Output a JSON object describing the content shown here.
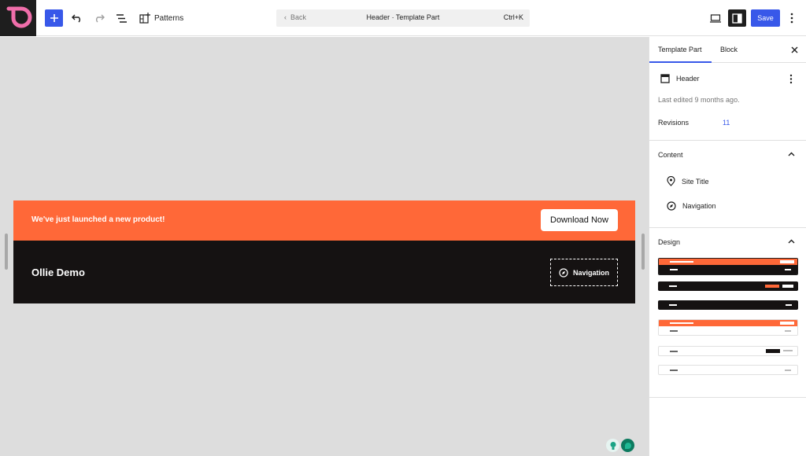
{
  "topbar": {
    "patterns_label": "Patterns",
    "command": {
      "back": "Back",
      "title": "Header · Template Part",
      "shortcut": "Ctrl+K"
    },
    "save_label": "Save"
  },
  "canvas": {
    "banner_text": "We've just launched a new product!",
    "download_label": "Download Now",
    "site_title": "Ollie Demo",
    "navigation_label": "Navigation"
  },
  "sidebar": {
    "tabs": [
      "Template Part",
      "Block"
    ],
    "part_name": "Header",
    "last_edited": "Last edited 9 months ago.",
    "revisions_label": "Revisions",
    "revisions_count": "11",
    "content_heading": "Content",
    "content_items": [
      "Site Title",
      "Navigation"
    ],
    "design_heading": "Design"
  },
  "colors": {
    "accent": "#3858e9",
    "banner_orange": "#ff6838",
    "header_dark": "#151212",
    "logo_pink": "#f06eaa"
  }
}
